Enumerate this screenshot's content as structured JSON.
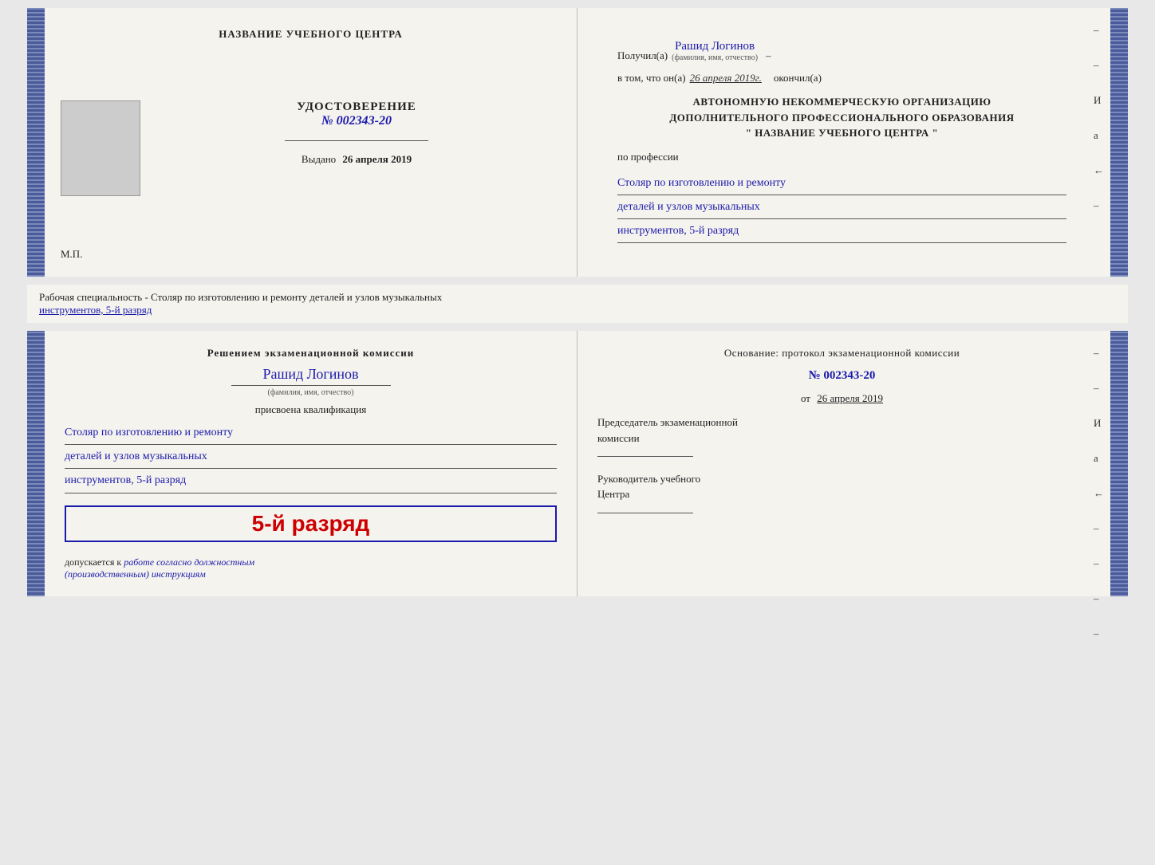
{
  "top": {
    "left": {
      "center_title": "НАЗВАНИЕ УЧЕБНОГО ЦЕНТРА",
      "udost_label": "УДОСТОВЕРЕНИЕ",
      "udost_num": "№ 002343-20",
      "vydano": "Выдано",
      "vydano_date": "26 апреля 2019",
      "mp": "М.П."
    },
    "right": {
      "poluchil": "Получил(а)",
      "name": "Рашид Логинов",
      "fio_label": "(фамилия, имя, отчество)",
      "vtom": "в том, что он(а)",
      "date": "26 апреля 2019г.",
      "okonchill": "окончил(а)",
      "org_line1": "АВТОНОМНУЮ НЕКОММЕРЧЕСКУЮ ОРГАНИЗАЦИЮ",
      "org_line2": "ДОПОЛНИТЕЛЬНОГО ПРОФЕССИОНАЛЬНОГО ОБРАЗОВАНИЯ",
      "org_line3": "\"   НАЗВАНИЕ УЧЕБНОГО ЦЕНТРА   \"",
      "po_professii": "по профессии",
      "prof_line1": "Столяр по изготовлению и ремонту",
      "prof_line2": "деталей и узлов музыкальных",
      "prof_line3": "инструментов, 5-й разряд"
    }
  },
  "specialty_text": "Рабочая специальность - Столяр по изготовлению и ремонту деталей и узлов музыкальных",
  "specialty_text2": "инструментов, 5-й разряд",
  "bottom": {
    "left": {
      "resheniem": "Решением экзаменационной  комиссии",
      "name": "Рашид Логинов",
      "fio_label": "(фамилия, имя, отчество)",
      "prisvoena": "присвоена квалификация",
      "prof_line1": "Столяр по изготовлению и ремонту",
      "prof_line2": "деталей и узлов музыкальных",
      "prof_line3": "инструментов, 5-й разряд",
      "razryad_big": "5-й разряд",
      "dopuskaetsya": "допускается к",
      "dopusk_italic": "работе согласно должностным",
      "dopusk_italic2": "(производственным) инструкциям"
    },
    "right": {
      "osnovanie": "Основание: протокол экзаменационной  комиссии",
      "num": "№  002343-20",
      "ot": "от",
      "ot_date": "26 апреля 2019",
      "chairman_title": "Председатель экзаменационной",
      "chairman_title2": "комиссии",
      "rukovoditel": "Руководитель учебного",
      "rukovoditel2": "Центра",
      "dash1": "–",
      "dash2": "–",
      "dash3": "–",
      "i": "И",
      "a": "а",
      "langle": "←",
      "dash4": "–",
      "dash5": "–",
      "dash6": "–",
      "dash7": "–"
    }
  }
}
